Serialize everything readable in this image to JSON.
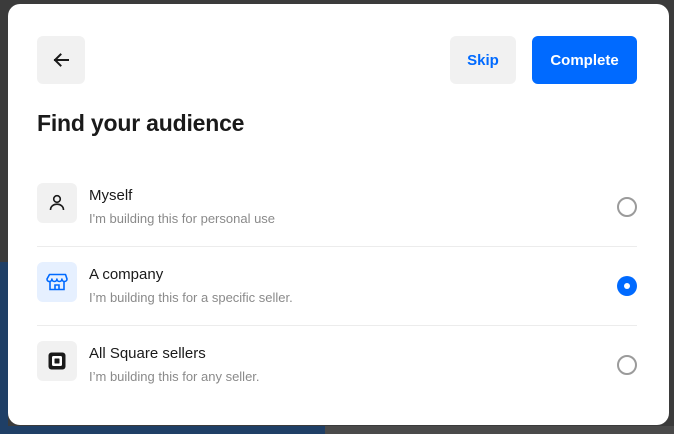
{
  "header": {
    "back_icon": "arrow-left-icon",
    "skip_label": "Skip",
    "complete_label": "Complete"
  },
  "title": "Find your audience",
  "options": [
    {
      "label": "Myself",
      "description": "I'm building this for personal use",
      "icon": "person-icon",
      "selected": false
    },
    {
      "label": "A company",
      "description": "I’m building this for a specific seller.",
      "icon": "storefront-icon",
      "selected": true
    },
    {
      "label": "All Square sellers",
      "description": "I’m building this for any seller.",
      "icon": "square-logo-icon",
      "selected": false
    }
  ],
  "colors": {
    "accent": "#006aff",
    "selected_icon_bg": "#e6f0ff",
    "button_secondary_bg": "#f1f1f1"
  }
}
